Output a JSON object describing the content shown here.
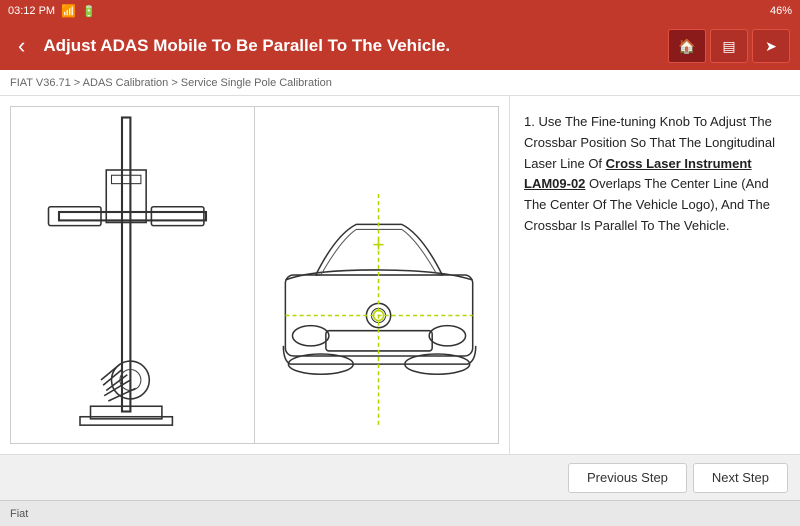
{
  "statusBar": {
    "time": "03:12 PM",
    "wifi": "wifi",
    "battery": "46%"
  },
  "header": {
    "backLabel": "‹",
    "title": "Adjust ADAS Mobile To Be Parallel To The Vehicle.",
    "icons": [
      "home",
      "adas",
      "share"
    ]
  },
  "breadcrumb": {
    "text": "FIAT V36.71 > ADAS Calibration > Service Single Pole Calibration"
  },
  "instructions": {
    "text": "1. Use The Fine-tuning Knob To Adjust The Crossbar Position So That The Longitudinal Laser Line Of ",
    "highlight": "Cross Laser Instrument LAM09-02",
    "textEnd": " Overlaps The Center Line (And The Center Of The Vehicle Logo), And The Crossbar Is Parallel To The Vehicle."
  },
  "footer": {
    "previousStep": "Previous Step",
    "nextStep": "Next Step"
  },
  "bottomBar": {
    "label": "Fiat"
  }
}
